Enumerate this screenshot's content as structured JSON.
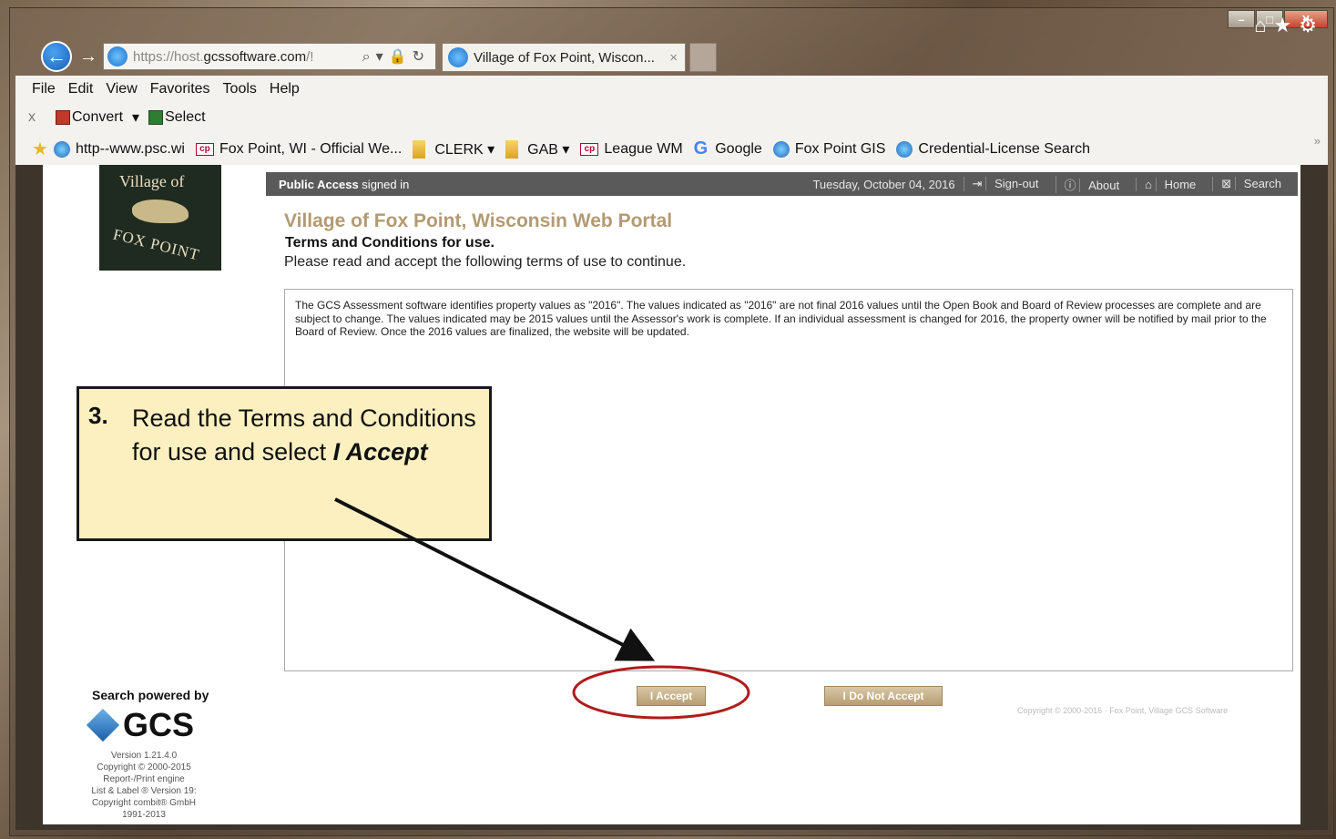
{
  "browser": {
    "url_prefix": "https://host.",
    "url_domain": "gcssoftware.com",
    "url_suffix": "/!",
    "tab_title": "Village of Fox Point, Wiscon...",
    "tab_close": "×"
  },
  "menu": [
    "File",
    "Edit",
    "View",
    "Favorites",
    "Tools",
    "Help"
  ],
  "commands": {
    "close": "x",
    "convert": "Convert",
    "select": "Select"
  },
  "favorites": [
    {
      "label": "http--www.psc.wi",
      "icon": "ie-icon"
    },
    {
      "label": "Fox Point, WI - Official We...",
      "icon": "cp-icon"
    },
    {
      "label": "CLERK ▾",
      "icon": "folder-icon"
    },
    {
      "label": "GAB ▾",
      "icon": "folder-icon"
    },
    {
      "label": "League WM",
      "icon": "cp-icon"
    },
    {
      "label": "Google",
      "icon": "google-icon"
    },
    {
      "label": "Fox Point GIS",
      "icon": "ie-icon"
    },
    {
      "label": "Credential-License Search",
      "icon": "ie-icon"
    }
  ],
  "logo": {
    "line1": "Village of",
    "line2": "FOX POINT"
  },
  "topbar": {
    "public_access": "Public Access",
    "signed_in": " signed in",
    "date": "Tuesday, October 04, 2016",
    "sign_out": "Sign-out",
    "about": "About",
    "home": "Home",
    "search": "Search"
  },
  "page": {
    "portal_title": "Village of Fox Point, Wisconsin Web Portal",
    "terms_title": "Terms and Conditions for use.",
    "terms_sub": "Please read and accept the following terms of use to continue.",
    "terms_text": "The GCS Assessment software identifies property values as \"2016\". The values indicated as \"2016\" are not final 2016 values until the Open Book and Board of Review processes are complete and are subject to change. The values indicated may be 2015 values until the Assessor's work is complete. If an individual assessment is changed for 2016, the property owner will be notified by mail prior to the Board of Review. Once the 2016 values are finalized, the website will be updated.",
    "accept_label": "I Accept",
    "decline_label": "I Do Not Accept",
    "copyright_right": "Copyright © 2000-2016 · Fox Point, Village GCS Software"
  },
  "footer": {
    "powered_by": "Search powered by",
    "gcs": "GCS",
    "version_lines": [
      "Version 1.21.4.0",
      "Copyright © 2000-2015",
      "Report-/Print engine",
      "List & Label ® Version 19:",
      "Copyright combit® GmbH",
      "1991-2013"
    ]
  },
  "callout": {
    "number": "3.",
    "text_pre": "Read the Terms and Conditions for use and select ",
    "text_bold": "I Accept"
  },
  "colors": {
    "portal_title": "#b39a72",
    "annotation_red": "#b01c1c",
    "callout_bg": "#fcf0c0"
  }
}
